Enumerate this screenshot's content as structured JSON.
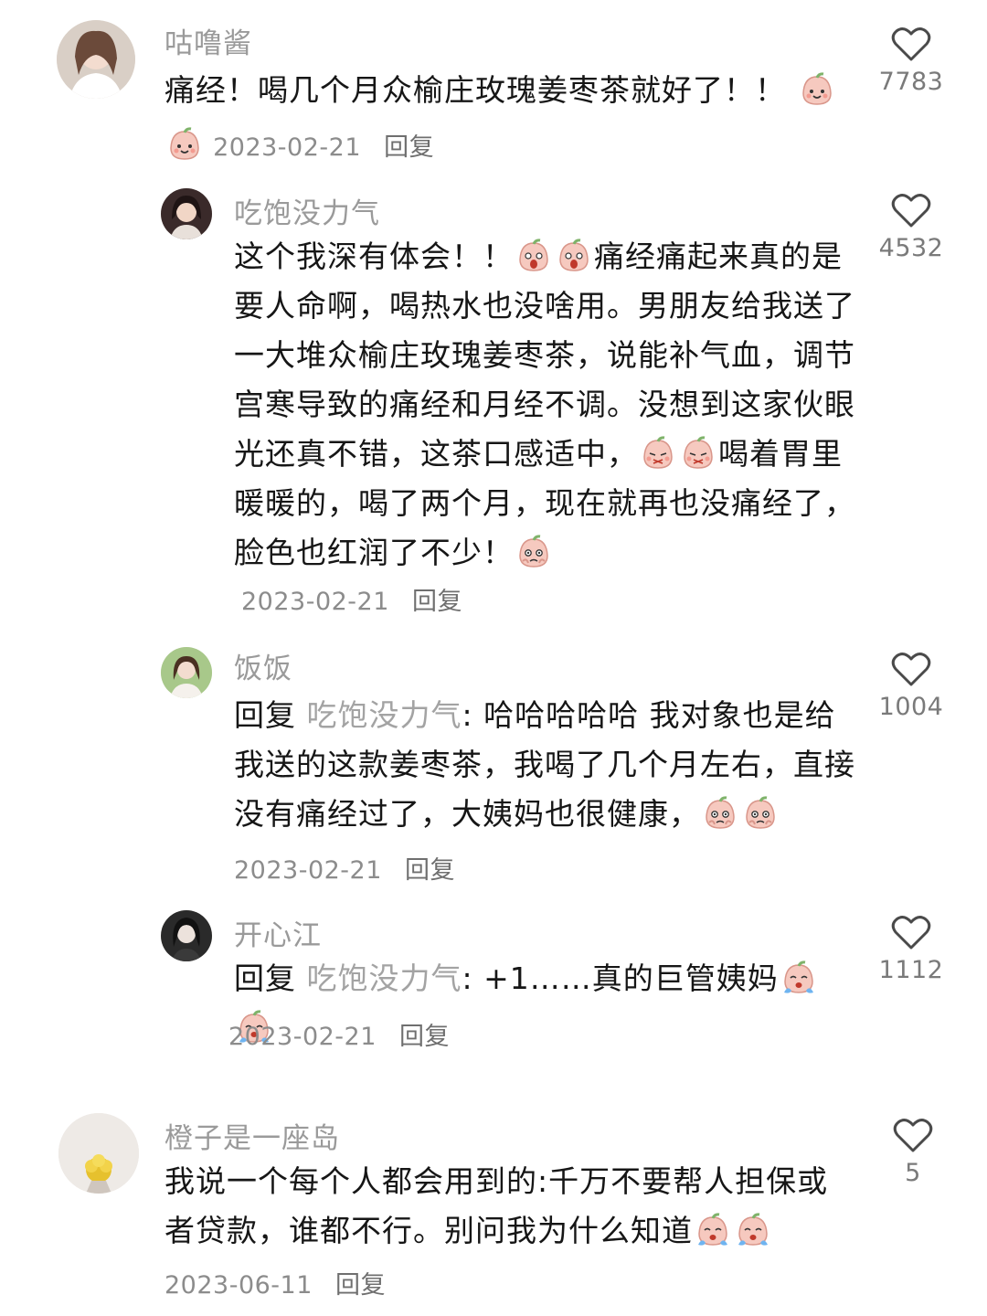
{
  "comments": [
    {
      "user": "咕噜酱",
      "text_a": "痛经！喝几个月众榆庄玫瑰姜枣茶就好了！！",
      "emoji_a": "peach-smile",
      "emoji_b": "peach-smile",
      "date": "2023-02-21",
      "reply_label": "回复",
      "likes": "7783"
    },
    {
      "user": "吃饱没力气",
      "text_a": "这个我深有体会！！",
      "text_b": "痛经痛起来真的是要人命啊，喝热水也没啥用。男朋友给我送了一大堆众榆庄玫瑰姜枣茶，说能补气血，调节宫寒导致的痛经和月经不调。没想到这家伙眼光还真不错，这茶口感适中，",
      "text_c": "喝着胃里暖暖的，喝了两个月，现在就再也没痛经了，脸色也红润了不少！",
      "emoji_a": "peach-shock",
      "emoji_b": "peach-shy",
      "emoji_c": "peach-touched",
      "date": "2023-02-21",
      "reply_label": "回复",
      "likes": "4532"
    },
    {
      "user": "饭饭",
      "prefix": "回复",
      "reply_to": "吃饱没力气",
      "text_a": ": 哈哈哈哈哈  我对象也是给我送的这款姜枣茶，我喝了几个月左右，直接没有痛经过了，大姨妈也很健康，",
      "emoji_a": "peach-touched",
      "date": "2023-02-21",
      "reply_label": "回复",
      "likes": "1004"
    },
    {
      "user": "开心江",
      "prefix": "回复",
      "reply_to": "吃饱没力气",
      "text_a": ": +1……真的巨管姨妈",
      "emoji_a": "peach-cry",
      "date": "2023-02-21",
      "reply_label": "回复",
      "likes": "1112"
    },
    {
      "user": "橙子是一座岛",
      "text_a": "我说一个每个人都会用到的:千万不要帮人担保或者贷款，谁都不行。别问我为什么知道",
      "emoji_a": "peach-cry",
      "date": "2023-06-11",
      "reply_label": "回复",
      "likes": "5"
    }
  ],
  "colors": {
    "username": "#9a9a9a",
    "text": "#161616",
    "meta": "#8c8c8c",
    "peach": "#f6c9bf",
    "heart_stroke": "#4a4a4a"
  }
}
